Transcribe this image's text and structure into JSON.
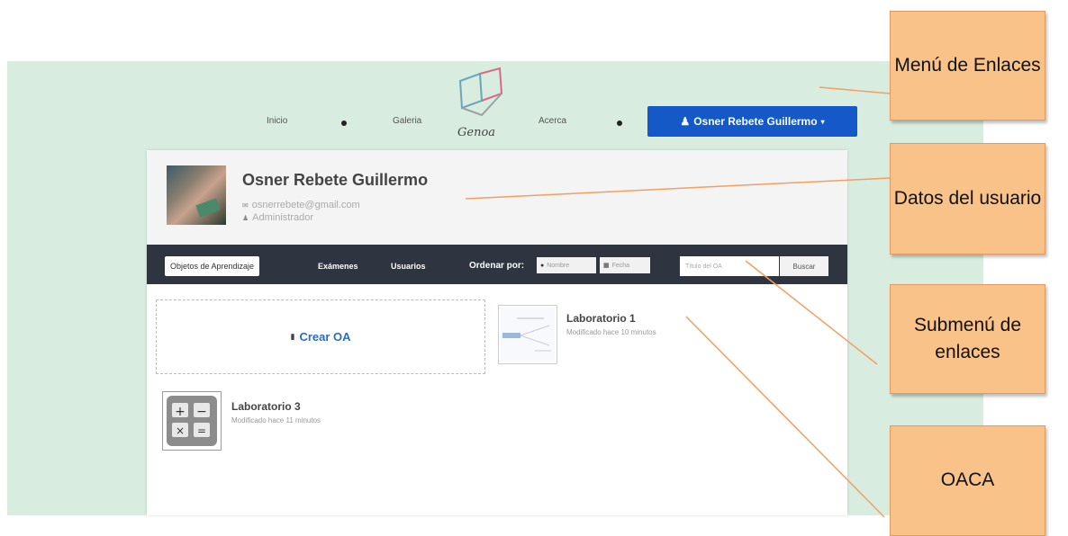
{
  "nav": {
    "links": [
      "Inicio",
      "Galeria",
      "Acerca"
    ],
    "logo_text": "Genoa",
    "user_button": "Osner Rebete Guillermo"
  },
  "profile": {
    "name": "Osner Rebete Guillermo",
    "email": "osnerrebete@gmail.com",
    "role": "Administrador"
  },
  "toolbar": {
    "tab_active": "Objetos de Aprendizaje",
    "tabs": [
      "Exámenes",
      "Usuarios"
    ],
    "order_label": "Ordenar por:",
    "order_options": [
      "Nombre",
      "Fecha"
    ],
    "search_placeholder": "Título del OA",
    "search_button": "Buscar"
  },
  "content": {
    "create_label": "Crear OA",
    "items": [
      {
        "title": "Laboratorio 1",
        "subtitle": "Modificado hace 10 minutos"
      },
      {
        "title": "Laboratorio 3",
        "subtitle": "Modificado hace 11 minutos"
      }
    ]
  },
  "callouts": [
    {
      "text": "Menú de Enlaces"
    },
    {
      "text": "Datos del usuario"
    },
    {
      "text": "Submenú de enlaces"
    },
    {
      "text": "OACA"
    }
  ],
  "colors": {
    "user_button": "#1559c8",
    "callout_fill": "#f8c288",
    "toolbar": "#2e3440",
    "mint_background": "#d8ecdf",
    "create_link": "#2a6dbf"
  }
}
